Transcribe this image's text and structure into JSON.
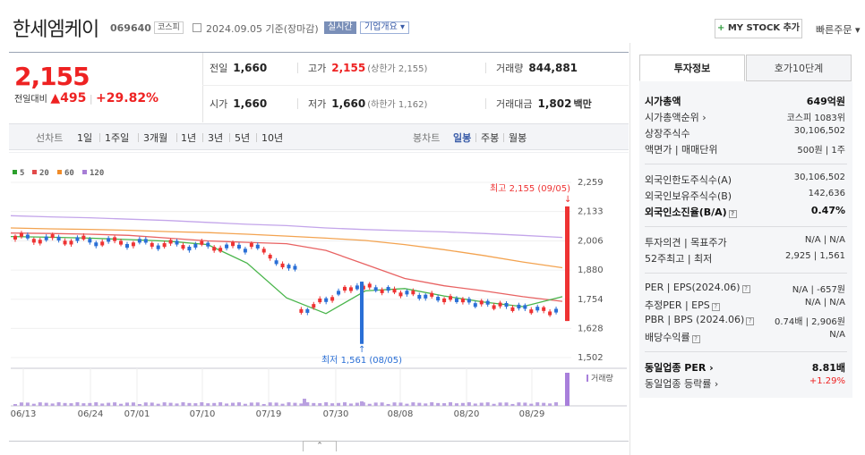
{
  "header": {
    "company_name": "한세엠케이",
    "stock_code": "069640",
    "market": "코스피",
    "date_text": "2024.09.05 기준(장마감)",
    "realtime": "실시간",
    "overview": "기업개요 ▾",
    "mystock_plus": "+",
    "mystock_label": " MY STOCK 추가",
    "quick_order": "빠른주문 ▾"
  },
  "price": {
    "current": "2,155",
    "change_label": "전일대비",
    "change_arrow": "▲",
    "change_value": "495",
    "change_sep": "|",
    "change_rate": "+29.82%",
    "prev_close_label": "전일",
    "prev_close": "1,660",
    "high_label": "고가",
    "high": "2,155",
    "upper_limit": "(상한가 2,155)",
    "volume_label": "거래량",
    "volume": "844,881",
    "open_label": "시가",
    "open": "1,660",
    "low_label": "저가",
    "low": "1,660",
    "lower_limit": "(하한가 1,162)",
    "amount_label": "거래대금",
    "amount": "1,802",
    "amount_unit": "백만"
  },
  "chart_tabs": {
    "periods": [
      "선차트",
      "1일",
      "1주일",
      "3개월",
      "1년",
      "3년",
      "5년",
      "10년"
    ],
    "candles": [
      "봉차트",
      "일봉",
      "주봉",
      "월봉"
    ],
    "active": "일봉"
  },
  "chart_data": {
    "type": "candlestick",
    "legend": [
      {
        "name": "5",
        "color": "#2ca02c"
      },
      {
        "name": "20",
        "color": "#e24a4a"
      },
      {
        "name": "60",
        "color": "#f08c2a"
      },
      {
        "name": "120",
        "color": "#a77ed6"
      }
    ],
    "y_ticks": [
      "2,259",
      "2,133",
      "2,006",
      "1,880",
      "1,754",
      "1,628",
      "1,502"
    ],
    "ylim": [
      1502,
      2259
    ],
    "x_ticks": [
      "06/13",
      "06/24",
      "07/01",
      "07/10",
      "07/19",
      "07/30",
      "08/08",
      "08/20",
      "08/29"
    ],
    "high_annotation": "최고 2,155 (09/05)",
    "low_annotation": "최저 1,561 (08/05)",
    "volume_label": "거래량",
    "ma120": [
      2115,
      2110,
      2106,
      2100,
      2094,
      2086,
      2078,
      2072,
      2062,
      2055,
      2050,
      2045,
      2038,
      2030,
      2021
    ],
    "ma60": [
      2062,
      2058,
      2056,
      2052,
      2046,
      2042,
      2035,
      2027,
      2018,
      2008,
      1990,
      1968,
      1943,
      1915,
      1890
    ],
    "ma20": [
      2040,
      2038,
      2035,
      2030,
      2018,
      2006,
      2000,
      1994,
      1965,
      1905,
      1844,
      1812,
      1790,
      1765,
      1745
    ],
    "ma5": [
      2025,
      2022,
      2018,
      2012,
      2005,
      1990,
      1910,
      1760,
      1692,
      1790,
      1800,
      1768,
      1742,
      1722,
      1765
    ]
  },
  "right_panel": {
    "tabs": [
      "투자정보",
      "호가10단계"
    ],
    "rows": [
      {
        "label": "시가총액",
        "value": "649억원",
        "bold": true
      },
      {
        "label": "시가총액순위 ›",
        "value": "코스피 1083위"
      },
      {
        "label": "상장주식수",
        "value": "30,106,502"
      },
      {
        "label": "액면가 | 매매단위",
        "value": "500원 | 1주"
      },
      {
        "label": "외국인한도주식수(A)",
        "value": "30,106,502"
      },
      {
        "label": "외국인보유주식수(B)",
        "value": "142,636"
      },
      {
        "label": "외국인소진율(B/A)",
        "value": "0.47%",
        "bold": true
      },
      {
        "label": "투자의견 | 목표주가",
        "value": "N/A | N/A"
      },
      {
        "label": "52주최고 | 최저",
        "value": "2,925 | 1,561"
      },
      {
        "label": "PER | EPS(2024.06)",
        "value": "N/A | -657원"
      },
      {
        "label": "추정PER | EPS",
        "value": "N/A | N/A"
      },
      {
        "label": "PBR | BPS (2024.06)",
        "value": "0.74배 | 2,906원"
      },
      {
        "label": "배당수익률",
        "value": "N/A"
      },
      {
        "label": "동일업종 PER ›",
        "value": "8.81배",
        "bold": true
      },
      {
        "label": "동일업종 등락률 ›",
        "value": "+1.29%",
        "up": true
      }
    ]
  },
  "collapse": "⌃"
}
